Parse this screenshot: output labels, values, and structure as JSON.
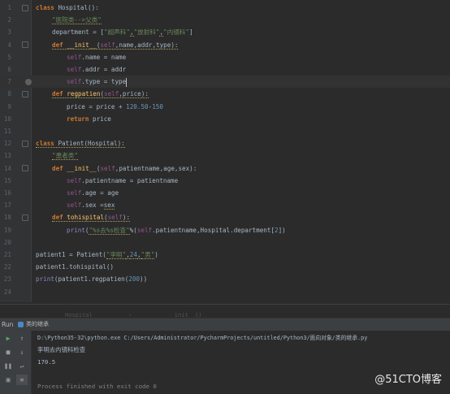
{
  "editor": {
    "lines": [
      {
        "n": "1"
      },
      {
        "n": "2"
      },
      {
        "n": "3"
      },
      {
        "n": "4"
      },
      {
        "n": "5"
      },
      {
        "n": "6"
      },
      {
        "n": "7"
      },
      {
        "n": "8"
      },
      {
        "n": "9"
      },
      {
        "n": "10"
      },
      {
        "n": "11"
      },
      {
        "n": "12"
      },
      {
        "n": "13"
      },
      {
        "n": "14"
      },
      {
        "n": "15"
      },
      {
        "n": "16"
      },
      {
        "n": "17"
      },
      {
        "n": "18"
      },
      {
        "n": "19"
      },
      {
        "n": "20"
      },
      {
        "n": "21"
      },
      {
        "n": "22"
      },
      {
        "n": "23"
      },
      {
        "n": "24"
      }
    ],
    "t": {
      "class": "class",
      "def": "def",
      "return": "return",
      "print": "print",
      "init": "__init__",
      "self": "self",
      "hospital": "Hospital",
      "patient": "Patient",
      "regpatien": "regpatien",
      "tohispital": "tohispital",
      "l1_tail": "():",
      "l2": "\"医院类-->父类\"",
      "l3_a": "department = [",
      "l3_s1": "\"超声科\"",
      "l3_s2": "\"放射科\"",
      "l3_s3": "\"内镜科\"",
      "l3_b": "]",
      "comma": ",",
      "l4_args": ",name,addr,type):",
      "l5": ".name = name",
      "l6": ".addr = addr",
      "l7": ".type = type",
      "l8_args": ",price):",
      "l9_a": "price = price + ",
      "l9_n1": "120",
      "l9_op": ".",
      "l9_n2": "50",
      "l9_minus": "-",
      "l9_n3": "150",
      "l10_tail": " price",
      "l12_open": "(",
      "l12_close": "):",
      "l13": "\"患者类\"",
      "l14_args": ",patientname,age,sex):",
      "l15": ".patientname = patientname",
      "l16": ".age = age",
      "l17_a": ".sex =",
      "l17_b": "sex",
      "l18_args": "):",
      "l19_a": "(",
      "l19_s": "\"%s去%s检查\"",
      "l19_b": "%(",
      "l19_c": ".patientname,Hospital.department[",
      "l19_n": "2",
      "l19_d": "])",
      "l21_a": "patient1 = Patient(",
      "l21_s1": "\"李明\"",
      "l21_n": "24",
      "l21_s2": "\"男\"",
      "l21_b": ")",
      "l22": "patient1.tohispital()",
      "l23_a": "(patient1.regpatien(",
      "l23_n": "200",
      "l23_b": "))",
      "paren": "(",
      "paren_close": ")",
      "colon_tail": "):"
    }
  },
  "breadcrumb": {
    "a": "Hospital",
    "sep": "›",
    "b": "__init__()"
  },
  "run": {
    "label": "Run",
    "tab": "类的继承"
  },
  "console": {
    "cmd": "D:\\Python35-32\\python.exe C:/Users/Administrator/PycharmProjects/untitled/Python3/面向对象/类的继承.py",
    "out1": "李明去内镜科检查",
    "out2": "170.5",
    "exit": "Process finished with exit code 0"
  },
  "watermark": "@51CTO博客",
  "colors": {
    "background": "#2b2b2b",
    "keyword": "#cc7832",
    "string": "#6a8759",
    "number": "#6897bb",
    "self": "#94558d",
    "function": "#ffc66d",
    "console_text": "#a9b7c6"
  }
}
